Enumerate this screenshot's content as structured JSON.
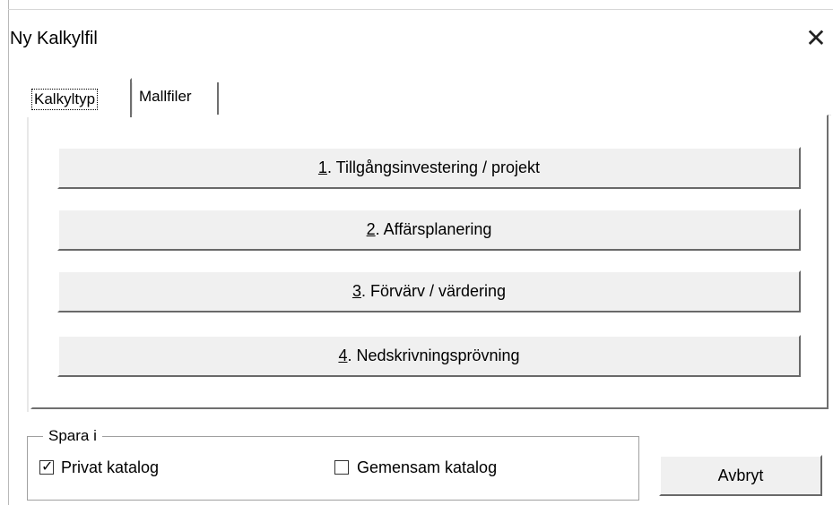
{
  "window": {
    "title": "Ny Kalkylfil",
    "close_glyph": "✕"
  },
  "tabs": [
    {
      "label": "Kalkyltyp",
      "active": true
    },
    {
      "label": "Mallfiler",
      "active": false
    }
  ],
  "calc_types": [
    {
      "number": "1",
      "label": ". Tillgångsinvestering / projekt"
    },
    {
      "number": "2",
      "label": ". Affärsplanering"
    },
    {
      "number": "3",
      "label": ". Förvärv / värdering"
    },
    {
      "number": "4",
      "label": ". Nedskrivningsprövning"
    }
  ],
  "save_in": {
    "legend": "Spara i",
    "options": [
      {
        "label": "Privat katalog",
        "checked": true,
        "mark": "✓"
      },
      {
        "label": "Gemensam katalog",
        "checked": false,
        "mark": ""
      }
    ]
  },
  "buttons": {
    "cancel": "Avbryt"
  },
  "colors": {
    "button_face": "#f0f0f0",
    "shadow": "#696969",
    "group_border": "#a0a0a0"
  }
}
